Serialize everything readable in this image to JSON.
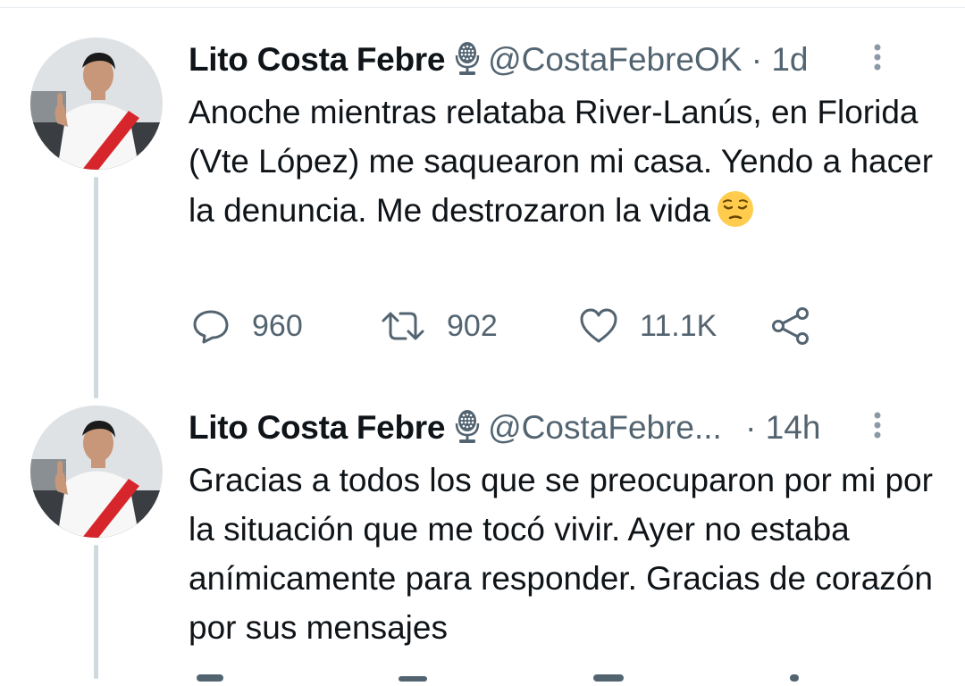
{
  "tweets": [
    {
      "author_name": "Lito Costa Febre",
      "handle": "@CostaFebreOK",
      "separator": "·",
      "time": "1d",
      "text": "Anoche mientras relataba River-Lanús, en Florida (Vte López) me saquearon mi casa. Yendo a hacer la denuncia. Me destrozaron la vida",
      "emoji": "pensive-face",
      "counts": {
        "replies": "960",
        "retweets": "902",
        "likes": "11.1K"
      }
    },
    {
      "author_name": "Lito Costa Febre",
      "handle": "@CostaFebre...",
      "separator": "·",
      "time": "14h",
      "text": "Gracias a todos los que se preocuparon por mi por la situación que me tocó vivir. Ayer no estaba anímicamente para responder. Gracias de corazón por sus mensajes"
    }
  ],
  "icons": {
    "author_badge": "microphone-icon",
    "more": "more-vertical-icon",
    "reply": "reply-icon",
    "retweet": "retweet-icon",
    "like": "heart-icon",
    "share": "share-icon"
  },
  "colors": {
    "text_primary": "#0f1419",
    "text_secondary": "#536471",
    "thread_line": "#cfd9de",
    "avatar_sash": "#d7262b"
  }
}
